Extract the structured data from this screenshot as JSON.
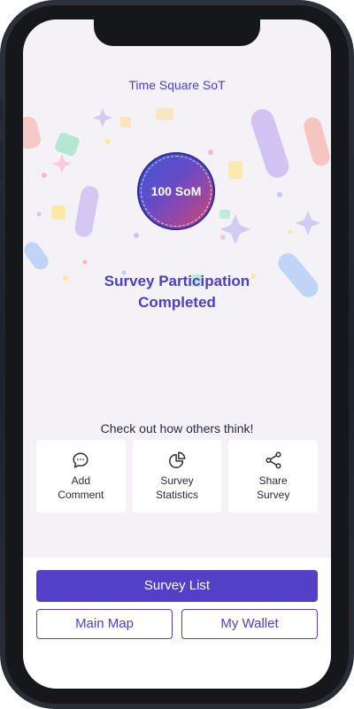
{
  "header": {
    "title": "Time Square SoT"
  },
  "reward": {
    "badge_text": "100 SoM"
  },
  "status": {
    "line1": "Survey Participation",
    "line2": "Completed"
  },
  "share_prompt": "Check out how others think!",
  "actions": [
    {
      "label": "Add\nComment",
      "icon": "comment-icon"
    },
    {
      "label": "Survey\nStatistics",
      "icon": "pie-chart-icon"
    },
    {
      "label": "Share\nSurvey",
      "icon": "share-icon"
    }
  ],
  "buttons": {
    "survey_list": "Survey List",
    "main_map": "Main Map",
    "my_wallet": "My Wallet"
  },
  "colors": {
    "accent": "#5340c6",
    "title": "#4b3fc6",
    "screen_bg": "#f4f2f7"
  }
}
